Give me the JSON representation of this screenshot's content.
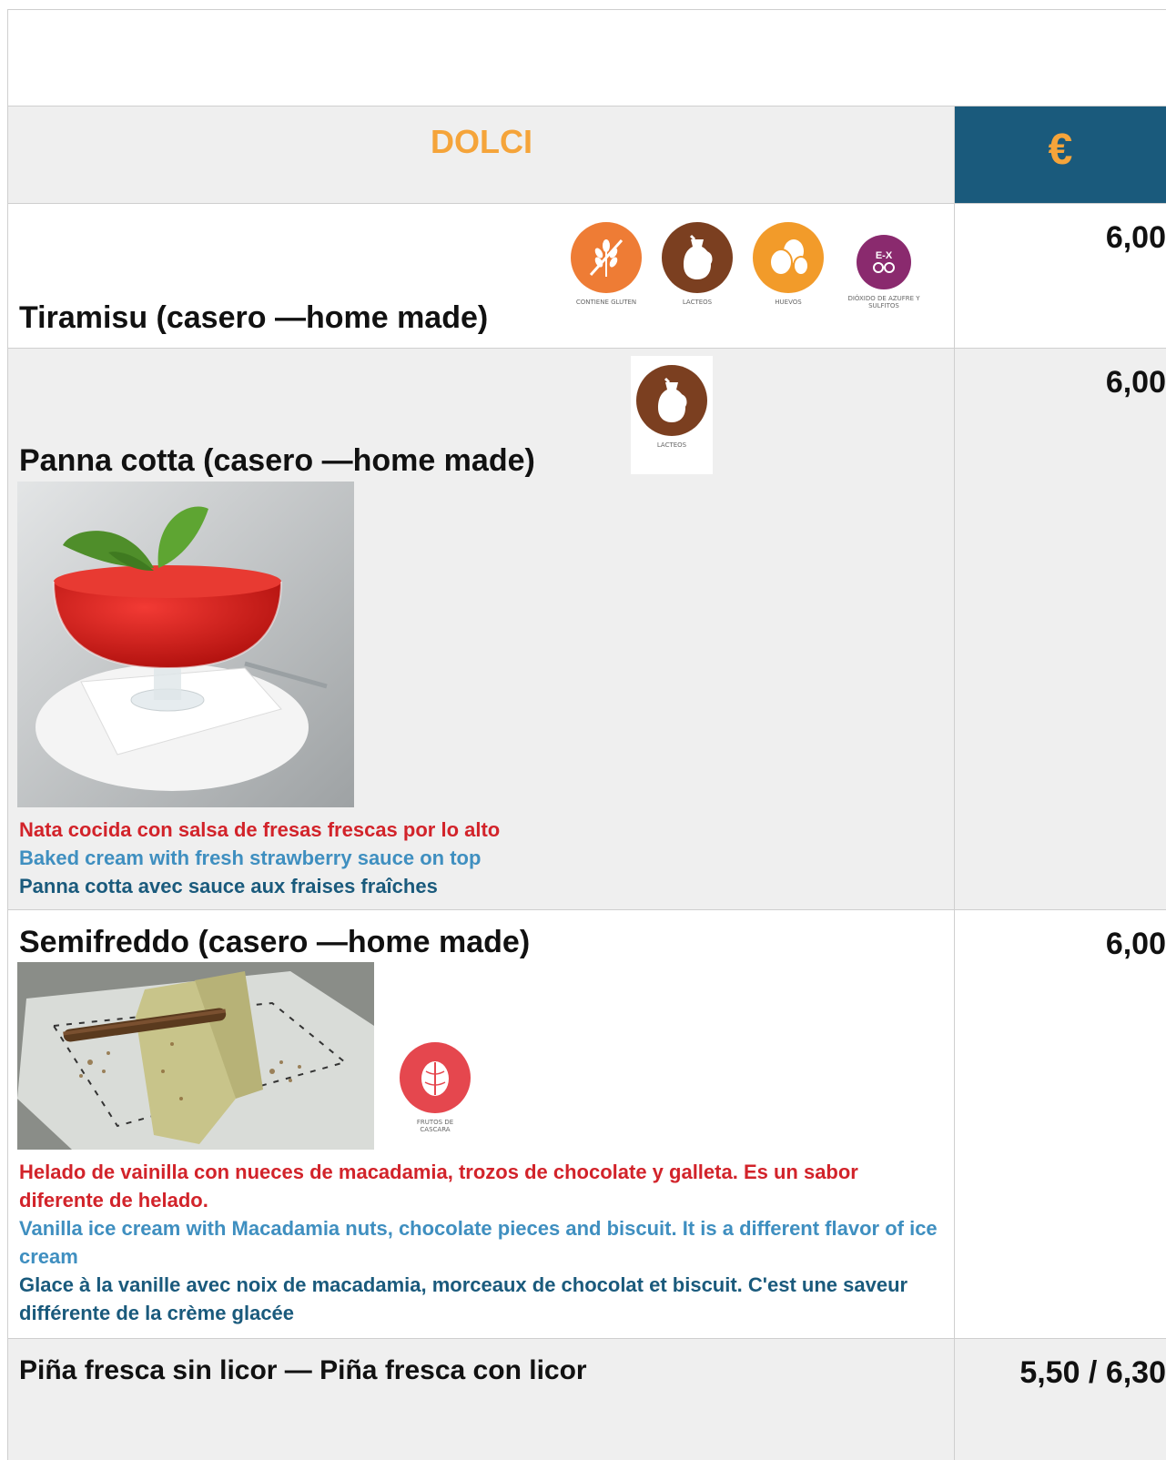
{
  "header": {
    "title": "DOLCI",
    "currency": "€"
  },
  "items": [
    {
      "name": "Tiramisu (casero —home made)",
      "price": "6,00"
    },
    {
      "name": "Panna cotta  (casero —home made)",
      "price": "6,00",
      "desc_es": "Nata cocida con salsa de fresas frescas por lo alto",
      "desc_en": "Baked cream with fresh strawberry sauce on top",
      "desc_fr": "Panna cotta avec sauce aux fraises fraîches"
    },
    {
      "name": "Semifreddo  (casero —home made)",
      "price": "6,00",
      "desc_es": "Helado de vainilla con nueces de macadamia, trozos de chocolate y galleta. Es un sabor diferente de helado.",
      "desc_en": "Vanilla ice cream with Macadamia nuts, chocolate pieces and biscuit. It is a different flavor of ice cream",
      "desc_fr": "Glace à la vanille avec noix de macadamia, morceaux de chocolat et biscuit. C'est une saveur différente de la crème glacée"
    },
    {
      "name": "Piña fresca  sin licor — Piña fresca  con licor",
      "price": "5,50 / 6,30"
    }
  ],
  "allergens": {
    "gluten": {
      "label": "CONTIENE GLUTEN",
      "color": "#ee7c35"
    },
    "lacteos": {
      "label": "LACTEOS",
      "color": "#7b3f20"
    },
    "huevos": {
      "label": "HUEVOS",
      "color": "#f29b2a"
    },
    "sulfitos": {
      "label": "DIÓXIDO DE AZUFRE Y SULFITOS",
      "color": "#8a2a6e",
      "glyph": "E-X"
    },
    "frutos": {
      "label": "FRUTOS DE CASCARA",
      "color": "#e5474e"
    }
  }
}
